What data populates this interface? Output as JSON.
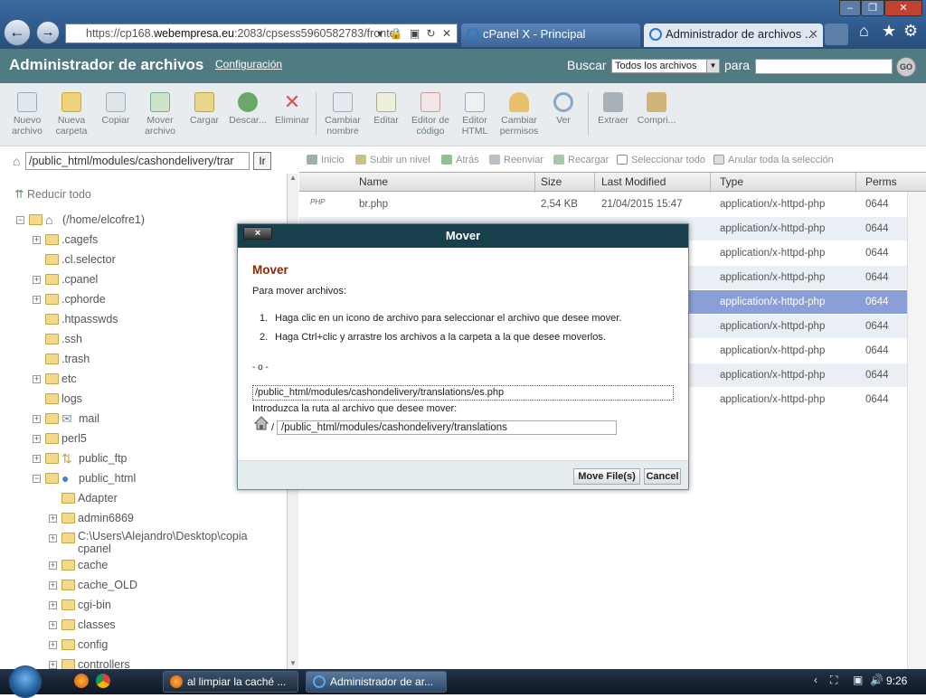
{
  "browser": {
    "url_prefix": "https://cp168.",
    "url_domain": "webempresa.eu",
    "url_suffix": ":2083/cpsess5960582783/fronter",
    "tabs": [
      {
        "label": "cPanel X - Principal"
      },
      {
        "label": "Administrador de archivos ..."
      }
    ]
  },
  "header": {
    "title": "Administrador de archivos",
    "config_link": "Configuración",
    "search_label": "Buscar",
    "search_scope": "Todos los archivos",
    "search_for": "para",
    "go_label": "GO"
  },
  "toolbar": [
    {
      "label": "Nuevo archivo",
      "icon": "new-file-icon"
    },
    {
      "label": "Nueva carpeta",
      "icon": "new-folder-icon"
    },
    {
      "label": "Copiar",
      "icon": "copy-icon"
    },
    {
      "label": "Mover archivo",
      "icon": "move-icon"
    },
    {
      "label": "Cargar",
      "icon": "upload-icon"
    },
    {
      "label": "Descar...",
      "icon": "download-icon"
    },
    {
      "label": "Eliminar",
      "icon": "delete-icon"
    },
    {
      "label": "Cambiar nombre",
      "icon": "rename-icon"
    },
    {
      "label": "Editar",
      "icon": "edit-icon"
    },
    {
      "label": "Editor de código",
      "icon": "code-editor-icon"
    },
    {
      "label": "Editor HTML",
      "icon": "html-editor-icon"
    },
    {
      "label": "Cambiar permisos",
      "icon": "permissions-icon"
    },
    {
      "label": "Ver",
      "icon": "view-icon"
    },
    {
      "label": "Extraer",
      "icon": "extract-icon"
    },
    {
      "label": "Compri...",
      "icon": "compress-icon"
    }
  ],
  "left": {
    "path": "/public_html/modules/cashondelivery/trar",
    "go": "Ir",
    "collapse": "Reducir todo",
    "tree": [
      {
        "label": "(/home/elcofre1)",
        "level": 0,
        "toggle": "−",
        "icon": "home"
      },
      {
        "label": ".cagefs",
        "level": 1,
        "toggle": "+"
      },
      {
        "label": ".cl.selector",
        "level": 1,
        "toggle": ""
      },
      {
        "label": ".cpanel",
        "level": 1,
        "toggle": "+"
      },
      {
        "label": ".cphorde",
        "level": 1,
        "toggle": "+"
      },
      {
        "label": ".htpasswds",
        "level": 1,
        "toggle": ""
      },
      {
        "label": ".ssh",
        "level": 1,
        "toggle": ""
      },
      {
        "label": ".trash",
        "level": 1,
        "toggle": ""
      },
      {
        "label": "etc",
        "level": 1,
        "toggle": "+"
      },
      {
        "label": "logs",
        "level": 1,
        "toggle": ""
      },
      {
        "label": "mail",
        "level": 1,
        "toggle": "+",
        "icon": "mail"
      },
      {
        "label": "perl5",
        "level": 1,
        "toggle": "+"
      },
      {
        "label": "public_ftp",
        "level": 1,
        "toggle": "+",
        "icon": "ftp"
      },
      {
        "label": "public_html",
        "level": 1,
        "toggle": "−",
        "icon": "globe"
      },
      {
        "label": "Adapter",
        "level": 2,
        "toggle": ""
      },
      {
        "label": "admin6869",
        "level": 2,
        "toggle": "+"
      },
      {
        "label": "C:\\Users\\Alejandro\\Desktop\\copia",
        "label2": "cpanel",
        "level": 2,
        "toggle": "+"
      },
      {
        "label": "cache",
        "level": 2,
        "toggle": "+"
      },
      {
        "label": "cache_OLD",
        "level": 2,
        "toggle": "+"
      },
      {
        "label": "cgi-bin",
        "level": 2,
        "toggle": "+"
      },
      {
        "label": "classes",
        "level": 2,
        "toggle": "+"
      },
      {
        "label": "config",
        "level": 2,
        "toggle": "+"
      },
      {
        "label": "controllers",
        "level": 2,
        "toggle": "+"
      }
    ]
  },
  "nav": [
    {
      "label": "Inicio",
      "icon": "home-icon"
    },
    {
      "label": "Subir un nivel",
      "icon": "up-level-icon"
    },
    {
      "label": "Atrás",
      "icon": "back-icon"
    },
    {
      "label": "Reenviar",
      "icon": "forward-icon"
    },
    {
      "label": "Recargar",
      "icon": "reload-icon"
    },
    {
      "label": "Seleccionar todo",
      "icon": "checkbox-checked-icon"
    },
    {
      "label": "Anular toda la selección",
      "icon": "checkbox-empty-icon"
    }
  ],
  "table": {
    "columns": [
      "Name",
      "Size",
      "Last Modified",
      "Type",
      "Perms"
    ],
    "rows": [
      {
        "name": "br.php",
        "size": "2,54 KB",
        "modified": "21/04/2015 15:47",
        "type": "application/x-httpd-php",
        "perms": "0644"
      },
      {
        "name": "",
        "size": "",
        "modified": "",
        "type": "application/x-httpd-php",
        "perms": "0644"
      },
      {
        "name": "",
        "size": "",
        "modified": "",
        "type": "application/x-httpd-php",
        "perms": "0644"
      },
      {
        "name": "",
        "size": "",
        "modified": "",
        "type": "application/x-httpd-php",
        "perms": "0644"
      },
      {
        "name": "",
        "size": "",
        "modified": "",
        "type": "application/x-httpd-php",
        "perms": "0644",
        "selected": true
      },
      {
        "name": "",
        "size": "",
        "modified": "",
        "type": "application/x-httpd-php",
        "perms": "0644"
      },
      {
        "name": "",
        "size": "",
        "modified": "",
        "type": "application/x-httpd-php",
        "perms": "0644"
      },
      {
        "name": "",
        "size": "",
        "modified": "",
        "type": "application/x-httpd-php",
        "perms": "0644"
      },
      {
        "name": "",
        "size": "",
        "modified": "",
        "type": "application/x-httpd-php",
        "perms": "0644"
      }
    ]
  },
  "modal": {
    "header": "Mover",
    "close": "×",
    "title": "Mover",
    "intro": "Para mover archivos:",
    "step1": "Haga clic en un icono de archivo para seleccionar el archivo que desee mover.",
    "step2": "Haga Ctrl+clic y arrastre los archivos a la carpeta a la que desee moverlos.",
    "or": "- o -",
    "source_path": "/public_html/modules/cashondelivery/translations/es.php",
    "prompt": "Introduzca la ruta al archivo que desee mover:",
    "slash": "/",
    "dest_path": "/public_html/modules/cashondelivery/translations",
    "move_button": "Move File(s)",
    "cancel_button": "Cancel"
  },
  "taskbar": {
    "tasks": [
      {
        "label": "al limpiar la caché ..."
      },
      {
        "label": "Administrador de ar..."
      }
    ],
    "clock": "9:26"
  }
}
